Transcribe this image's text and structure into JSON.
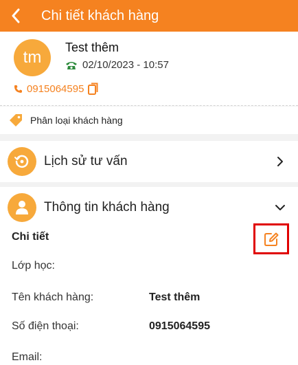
{
  "header": {
    "title": "Chi tiết khách hàng",
    "back_icon": "chevron-left-icon"
  },
  "customer": {
    "initials": "tm",
    "name": "Test thêm",
    "created": "02/10/2023 - 10:57",
    "phone": "0915064595"
  },
  "classification": {
    "label": "Phân loại khách hàng"
  },
  "sections": {
    "history": {
      "title": "Lịch sử tư vấn"
    },
    "info": {
      "title": "Thông tin khách hàng"
    }
  },
  "detail": {
    "title": "Chi tiết",
    "fields": [
      {
        "label": "Lớp học:",
        "value": ""
      },
      {
        "label": "Tên khách hàng:",
        "value": "Test thêm"
      },
      {
        "label": "Số điện thoại:",
        "value": "0915064595"
      },
      {
        "label": "Email:",
        "value": ""
      }
    ]
  },
  "colors": {
    "accent": "#f58220",
    "avatar": "#f7a93b",
    "highlight": "#e00000"
  }
}
